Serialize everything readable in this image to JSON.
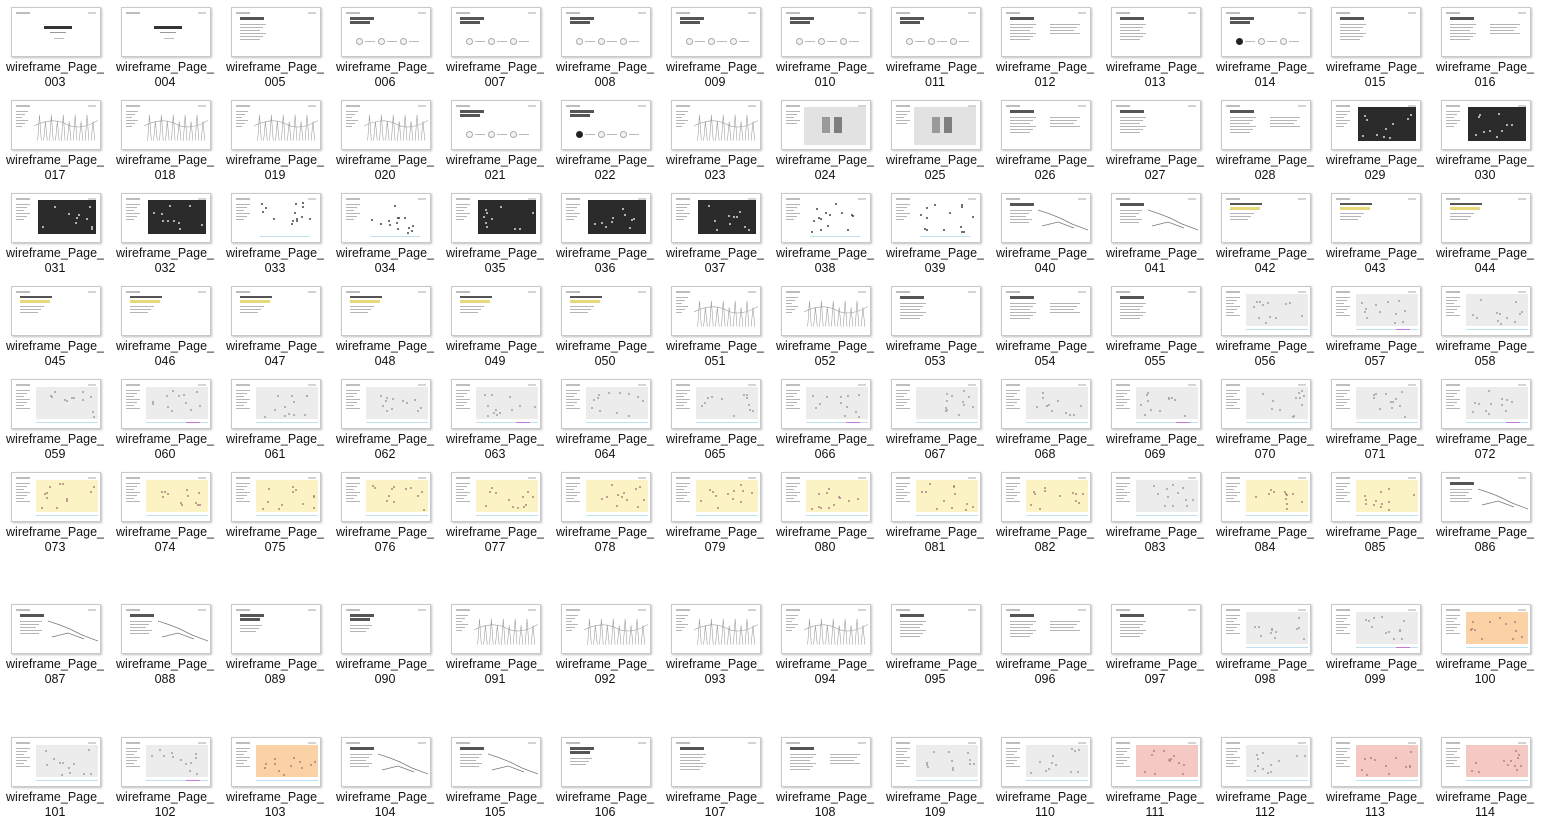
{
  "file_prefix": "wireframe_Page_",
  "thumbnails": [
    {
      "number": "003",
      "kind": "cover"
    },
    {
      "number": "004",
      "kind": "cover"
    },
    {
      "number": "005",
      "kind": "text"
    },
    {
      "number": "006",
      "kind": "circles"
    },
    {
      "number": "007",
      "kind": "circles"
    },
    {
      "number": "008",
      "kind": "circles"
    },
    {
      "number": "009",
      "kind": "circles"
    },
    {
      "number": "010",
      "kind": "circles"
    },
    {
      "number": "011",
      "kind": "circles"
    },
    {
      "number": "012",
      "kind": "text"
    },
    {
      "number": "013",
      "kind": "text"
    },
    {
      "number": "014",
      "kind": "circles-dark"
    },
    {
      "number": "015",
      "kind": "text"
    },
    {
      "number": "016",
      "kind": "text"
    },
    {
      "number": "017",
      "kind": "sketch"
    },
    {
      "number": "018",
      "kind": "sketch"
    },
    {
      "number": "019",
      "kind": "sketch"
    },
    {
      "number": "020",
      "kind": "sketch"
    },
    {
      "number": "021",
      "kind": "circles"
    },
    {
      "number": "022",
      "kind": "circles-dark"
    },
    {
      "number": "023",
      "kind": "sketch"
    },
    {
      "number": "024",
      "kind": "photo-light"
    },
    {
      "number": "025",
      "kind": "photo-light"
    },
    {
      "number": "026",
      "kind": "text"
    },
    {
      "number": "027",
      "kind": "text"
    },
    {
      "number": "028",
      "kind": "text"
    },
    {
      "number": "029",
      "kind": "dark"
    },
    {
      "number": "030",
      "kind": "dark"
    },
    {
      "number": "031",
      "kind": "dark"
    },
    {
      "number": "032",
      "kind": "dark"
    },
    {
      "number": "033",
      "kind": "scatter-white"
    },
    {
      "number": "034",
      "kind": "scatter-white"
    },
    {
      "number": "035",
      "kind": "dark"
    },
    {
      "number": "036",
      "kind": "dark"
    },
    {
      "number": "037",
      "kind": "dark"
    },
    {
      "number": "038",
      "kind": "scatter-white"
    },
    {
      "number": "039",
      "kind": "scatter-white"
    },
    {
      "number": "040",
      "kind": "lines"
    },
    {
      "number": "041",
      "kind": "lines"
    },
    {
      "number": "042",
      "kind": "title-yellow"
    },
    {
      "number": "043",
      "kind": "title-yellow"
    },
    {
      "number": "044",
      "kind": "title-yellow"
    },
    {
      "number": "045",
      "kind": "title-yellow"
    },
    {
      "number": "046",
      "kind": "title-yellow"
    },
    {
      "number": "047",
      "kind": "title-yellow"
    },
    {
      "number": "048",
      "kind": "title-yellow"
    },
    {
      "number": "049",
      "kind": "title-yellow"
    },
    {
      "number": "050",
      "kind": "title-yellow"
    },
    {
      "number": "051",
      "kind": "sketch"
    },
    {
      "number": "052",
      "kind": "sketch"
    },
    {
      "number": "053",
      "kind": "text"
    },
    {
      "number": "054",
      "kind": "text"
    },
    {
      "number": "055",
      "kind": "text"
    },
    {
      "number": "056",
      "kind": "panel-gray"
    },
    {
      "number": "057",
      "kind": "panel-gray"
    },
    {
      "number": "058",
      "kind": "panel-gray"
    },
    {
      "number": "059",
      "kind": "panel-gray"
    },
    {
      "number": "060",
      "kind": "panel-gray"
    },
    {
      "number": "061",
      "kind": "panel-gray"
    },
    {
      "number": "062",
      "kind": "panel-gray"
    },
    {
      "number": "063",
      "kind": "panel-gray"
    },
    {
      "number": "064",
      "kind": "panel-gray"
    },
    {
      "number": "065",
      "kind": "panel-gray"
    },
    {
      "number": "066",
      "kind": "panel-gray"
    },
    {
      "number": "067",
      "kind": "panel-gray"
    },
    {
      "number": "068",
      "kind": "panel-gray"
    },
    {
      "number": "069",
      "kind": "panel-gray"
    },
    {
      "number": "070",
      "kind": "panel-gray"
    },
    {
      "number": "071",
      "kind": "panel-gray"
    },
    {
      "number": "072",
      "kind": "panel-gray"
    },
    {
      "number": "073",
      "kind": "panel-yellow"
    },
    {
      "number": "074",
      "kind": "panel-yellow"
    },
    {
      "number": "075",
      "kind": "panel-yellow"
    },
    {
      "number": "076",
      "kind": "panel-yellow"
    },
    {
      "number": "077",
      "kind": "panel-yellow"
    },
    {
      "number": "078",
      "kind": "panel-yellow"
    },
    {
      "number": "079",
      "kind": "panel-yellow"
    },
    {
      "number": "080",
      "kind": "panel-yellow"
    },
    {
      "number": "081",
      "kind": "panel-yellow"
    },
    {
      "number": "082",
      "kind": "panel-yellow"
    },
    {
      "number": "083",
      "kind": "panel-gray"
    },
    {
      "number": "084",
      "kind": "panel-yellow"
    },
    {
      "number": "085",
      "kind": "panel-yellow"
    },
    {
      "number": "086",
      "kind": "lines"
    },
    {
      "number": "087",
      "kind": "lines"
    },
    {
      "number": "088",
      "kind": "lines"
    },
    {
      "number": "089",
      "kind": "title"
    },
    {
      "number": "090",
      "kind": "title"
    },
    {
      "number": "091",
      "kind": "sketch"
    },
    {
      "number": "092",
      "kind": "sketch"
    },
    {
      "number": "093",
      "kind": "sketch"
    },
    {
      "number": "094",
      "kind": "sketch"
    },
    {
      "number": "095",
      "kind": "text"
    },
    {
      "number": "096",
      "kind": "text"
    },
    {
      "number": "097",
      "kind": "text"
    },
    {
      "number": "098",
      "kind": "panel-gray"
    },
    {
      "number": "099",
      "kind": "panel-gray"
    },
    {
      "number": "100",
      "kind": "panel-orange"
    },
    {
      "number": "101",
      "kind": "panel-gray"
    },
    {
      "number": "102",
      "kind": "panel-gray"
    },
    {
      "number": "103",
      "kind": "panel-orange"
    },
    {
      "number": "104",
      "kind": "lines"
    },
    {
      "number": "105",
      "kind": "lines"
    },
    {
      "number": "106",
      "kind": "title"
    },
    {
      "number": "107",
      "kind": "text"
    },
    {
      "number": "108",
      "kind": "text"
    },
    {
      "number": "109",
      "kind": "panel-gray"
    },
    {
      "number": "110",
      "kind": "panel-gray"
    },
    {
      "number": "111",
      "kind": "panel-red"
    },
    {
      "number": "112",
      "kind": "panel-gray"
    },
    {
      "number": "113",
      "kind": "panel-red"
    },
    {
      "number": "114",
      "kind": "panel-red"
    }
  ],
  "colors": {
    "label_text": "#111111",
    "thumb_border": "#c9c9c9",
    "panel_gray": "#ececec",
    "panel_yellow": "#fbf3c4",
    "panel_orange": "#fad2a6",
    "panel_red": "#f4c9c4",
    "dark": "#2b2b2b",
    "accent_yellow": "#e7d87a",
    "accent_blue": "#bfe0f1",
    "accent_purple": "#c77bd6"
  }
}
